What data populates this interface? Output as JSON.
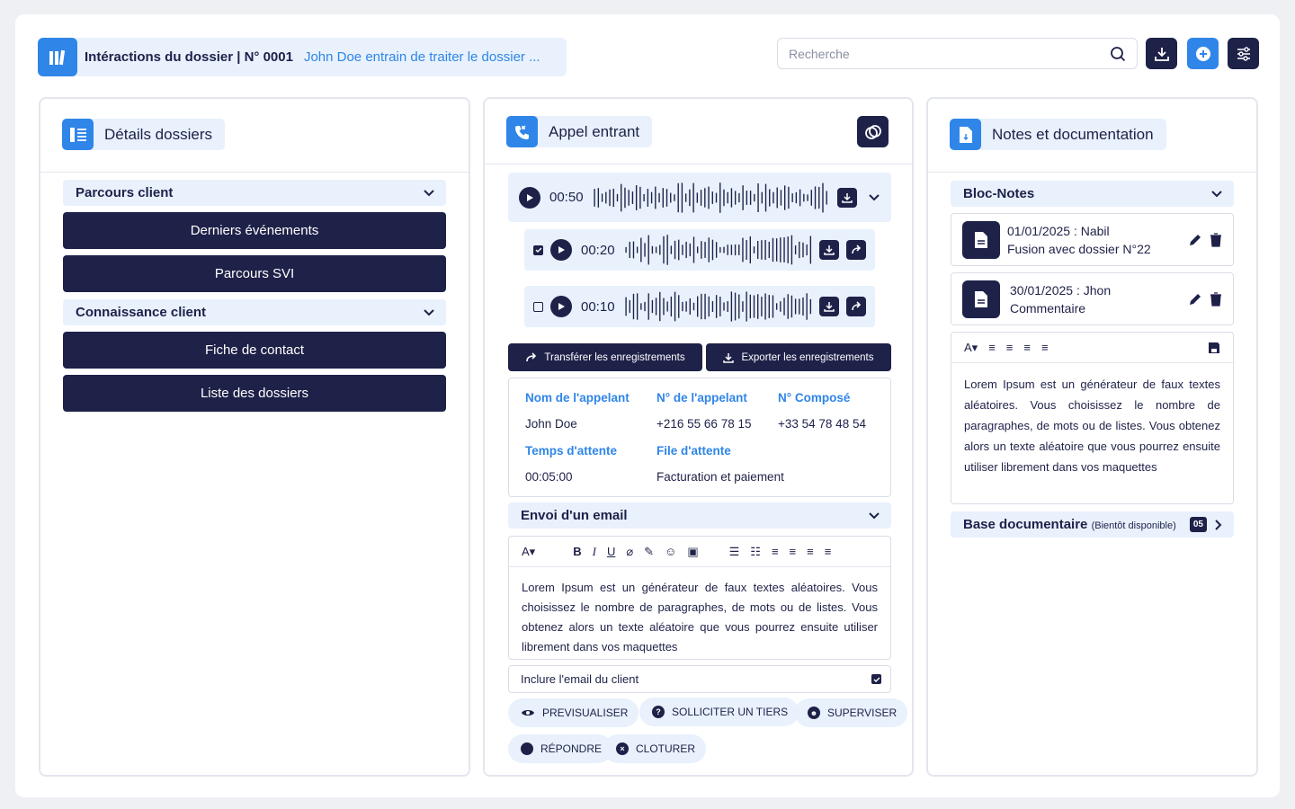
{
  "header": {
    "title": "Intéractions du dossier | N° 0001",
    "subtitle": "John Doe entrain de traiter le dossier ...",
    "search_placeholder": "Recherche"
  },
  "left": {
    "title": "Détails dossiers",
    "section1": "Parcours client",
    "btn1": "Derniers événements",
    "btn2": "Parcours SVI",
    "section2": "Connaissance client",
    "btn3": "Fiche de contact",
    "btn4": "Liste des dossiers"
  },
  "middle": {
    "title": "Appel entrant",
    "audio_main_time": "00:50",
    "audio_sub1_time": "00:20",
    "audio_sub2_time": "00:10",
    "audio_sub1_checked": true,
    "audio_sub2_checked": false,
    "transfer_label": "Transférer les enregistrements",
    "export_label": "Exporter les enregistrements",
    "info": {
      "caller_name_label": "Nom de l'appelant",
      "caller_name": "John Doe",
      "caller_number_label": "N° de l'appelant",
      "caller_number": "+216 55 66 78 15",
      "dialed_label": "N° Composé",
      "dialed": "+33 54 78 48  54",
      "wait_label": "Temps d'attente",
      "wait": "00:05:00",
      "queue_label": "File d'attente",
      "queue": "Facturation et paiement"
    },
    "email_section": "Envoi d'un email",
    "email_body": "Lorem Ipsum est un générateur de faux textes aléatoires. Vous choisissez le nombre de paragraphes, de mots ou de listes. Vous obtenez alors un texte aléatoire que vous pourrez ensuite utiliser librement dans vos maquettes",
    "include_email": "Inclure l'email du client",
    "actions": {
      "preview": "PREVISUALISER",
      "third": "SOLLICITER UN TIERS",
      "supervise": "SUPERVISER",
      "reply": "RÉPONDRE",
      "close": "CLOTURER"
    }
  },
  "right": {
    "title": "Notes et documentation",
    "bloc_notes": "Bloc-Notes",
    "notes": [
      {
        "date": "01/01/2025 :",
        "author": "Nabil",
        "text": "Fusion avec dossier N°22"
      },
      {
        "date": "30/01/2025 :",
        "author": "Jhon",
        "text": "Commentaire"
      }
    ],
    "editor_body": "Lorem Ipsum est un générateur de faux textes aléatoires. Vous choisissez le nombre de paragraphes, de mots ou de listes. Vous obtenez alors un texte aléatoire que vous pourrez ensuite utiliser librement dans vos maquettes",
    "base_doc": "Base documentaire",
    "base_doc_note": "(Bientôt disponible)",
    "base_doc_count": "05"
  },
  "colors": {
    "navy": "#1e2148",
    "blue": "#2f86e8",
    "light": "#e8f1fc"
  }
}
